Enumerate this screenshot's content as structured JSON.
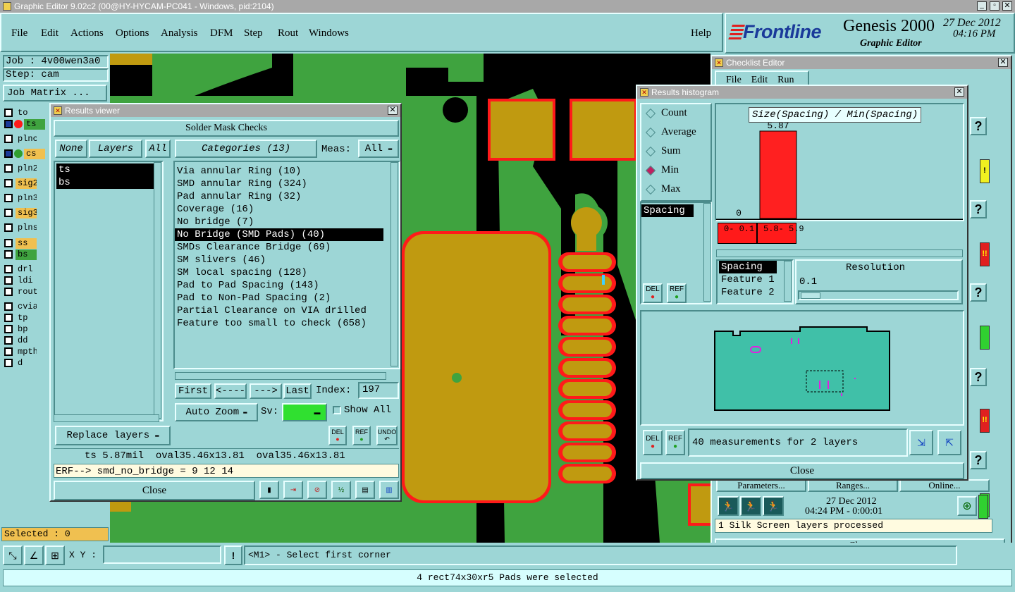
{
  "titlebar": {
    "title": "Graphic Editor 9.02c2 (00@HY-HYCAM-PC041 - Windows, pid:2104)"
  },
  "menu": {
    "items": [
      "File",
      "Edit",
      "Actions",
      "Options",
      "Analysis",
      "DFM",
      "Step",
      "Rout",
      "Windows"
    ],
    "help": "Help"
  },
  "brand": {
    "logo": "Frontline",
    "product": "Genesis 2000",
    "subtitle": "Graphic Editor",
    "date": "27 Dec 2012",
    "time": "04:16 PM"
  },
  "job": {
    "job_label": "Job : 4v00wen3a0",
    "step_label": "Step: cam",
    "matrix_button": "Job Matrix ..."
  },
  "layers": [
    {
      "name": "to",
      "color": "#9dd6d6"
    },
    {
      "name": "ts",
      "color": "#3fa33f",
      "marker": "red"
    },
    {
      "name": "plnc",
      "color": "#9dd6d6"
    },
    {
      "name": "cs",
      "color": "#f0c050",
      "marker": "green"
    },
    {
      "name": "pln2",
      "color": "#9dd6d6"
    },
    {
      "name": "sig2",
      "color": "#f0c050"
    },
    {
      "name": "pln3",
      "color": "#9dd6d6"
    },
    {
      "name": "sig3",
      "color": "#f0c050"
    },
    {
      "name": "plns",
      "color": "#9dd6d6"
    },
    {
      "name": "ss",
      "color": "#f0c050"
    },
    {
      "name": "bs",
      "color": "#3fa33f"
    },
    {
      "name": "drl",
      "color": "#9dd6d6"
    },
    {
      "name": "ldi",
      "color": "#9dd6d6"
    },
    {
      "name": "rout",
      "color": "#9dd6d6"
    },
    {
      "name": "cvia",
      "color": "#9dd6d6"
    },
    {
      "name": "tp",
      "color": "#9dd6d6"
    },
    {
      "name": "bp",
      "color": "#9dd6d6"
    },
    {
      "name": "dd",
      "color": "#9dd6d6"
    },
    {
      "name": "mpth",
      "color": "#9dd6d6"
    },
    {
      "name": "d",
      "color": "#9dd6d6"
    }
  ],
  "status": {
    "selected": "Selected : 0",
    "xy_label": "X Y :",
    "prompt": "<M1> - Select first corner",
    "bottom_msg": "4 rect74x30xr5 Pads were selected"
  },
  "results_viewer": {
    "title": "Results viewer",
    "header": "Solder Mask Checks",
    "none_btn": "None",
    "layers_btn": "Layers",
    "all_btn": "All",
    "layer_list": [
      "ts",
      "bs"
    ],
    "categories_btn": "Categories (13)",
    "meas_label": "Meas:",
    "meas_value": "All",
    "categories": [
      "Via annular Ring (10)",
      "SMD annular Ring (324)",
      "Pad annular Ring (32)",
      "Coverage (16)",
      "No bridge (7)",
      "No Bridge (SMD Pads) (40)",
      "SMDs Clearance Bridge (69)",
      "SM slivers (46)",
      "SM local spacing (128)",
      "Pad to Pad Spacing (143)",
      "Pad to Non-Pad Spacing (2)",
      "Partial Clearance on VIA drilled",
      "Feature too small to check (658)"
    ],
    "selected_category": 5,
    "nav": {
      "first": "First",
      "prev": "<----",
      "next": "--->",
      "last": "Last",
      "index_label": "Index:",
      "index_value": "197"
    },
    "auto_zoom": "Auto Zoom",
    "sv_label": "Sv:",
    "show_all": "Show All",
    "replace_layers": "Replace layers",
    "del": "DEL",
    "ref": "REF",
    "undo": "UNDO",
    "info_line": "ts 5.87mil  oval35.46x13.81  oval35.46x13.81",
    "erf_line": "ERF--> smd_no_bridge = 9 12 14",
    "close": "Close"
  },
  "histogram": {
    "title": "Results histogram",
    "modes": [
      "Count",
      "Average",
      "Sum",
      "Min",
      "Max"
    ],
    "selected_mode": "Min",
    "measure_list": [
      "Spacing"
    ],
    "chart_title": "Size(Spacing) / Min(Spacing)",
    "axis_min_label": "0",
    "del": "DEL",
    "ref": "REF",
    "types": [
      "Spacing",
      "Feature 1",
      "Feature 2"
    ],
    "resolution_label": "Resolution",
    "resolution_value": "0.1",
    "measurements": "40 measurements for 2 layers",
    "close": "Close"
  },
  "chart_data": {
    "type": "bar",
    "title": "Size(Spacing) / Min(Spacing)",
    "categories": [
      "0- 0.1",
      "5.8- 5.9"
    ],
    "values": [
      0,
      5.87
    ],
    "value_labels": [
      "0",
      "5.87"
    ],
    "bar_color": "#ff2020",
    "grid": false
  },
  "checklist": {
    "title": "Checklist Editor",
    "menu": [
      "File",
      "Edit",
      "Run"
    ],
    "parameters": "Parameters...",
    "ranges": "Ranges...",
    "online": "Online...",
    "date": "27 Dec 2012",
    "time": "04:24 PM - 0:00:01",
    "status": "1 Silk Screen layers processed",
    "close": "Close"
  }
}
